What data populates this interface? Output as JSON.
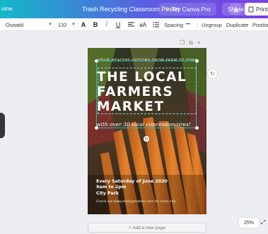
{
  "topbar": {
    "home_label": "ome",
    "doc_title": "Trash Recycling Classroom Poster",
    "try_pro_label": "Try Canva Pro",
    "share_label": "Share",
    "print_label": "Print P"
  },
  "toolbar": {
    "font_name": "Oswald",
    "font_size": "132",
    "spacing_label": "Spacing",
    "more_label": "•••",
    "ungroup_label": "Ungroup",
    "duplicate_label": "Duplicate",
    "position_label": "Position"
  },
  "poster": {
    "tagline": "YOUR HEALTHY OPTIONS FROM FARM TO FORK",
    "headline": [
      "THE LOCAL",
      "FARMERS",
      "MARKET"
    ],
    "subline": "with over 30 local concessionaires!",
    "details": [
      "Every Saturday of June 2020",
      "9am to 2pm",
      "City Park"
    ],
    "cta": "Check out www.reallygreatsite.com for more info."
  },
  "canvas": {
    "add_page_label": "+ Add a new page",
    "zoom_label": "25%"
  },
  "colors": {
    "brand_gradient_start": "#14b8c8",
    "brand_gradient_end": "#7b3fe4",
    "selection": "#1fc2b0"
  }
}
